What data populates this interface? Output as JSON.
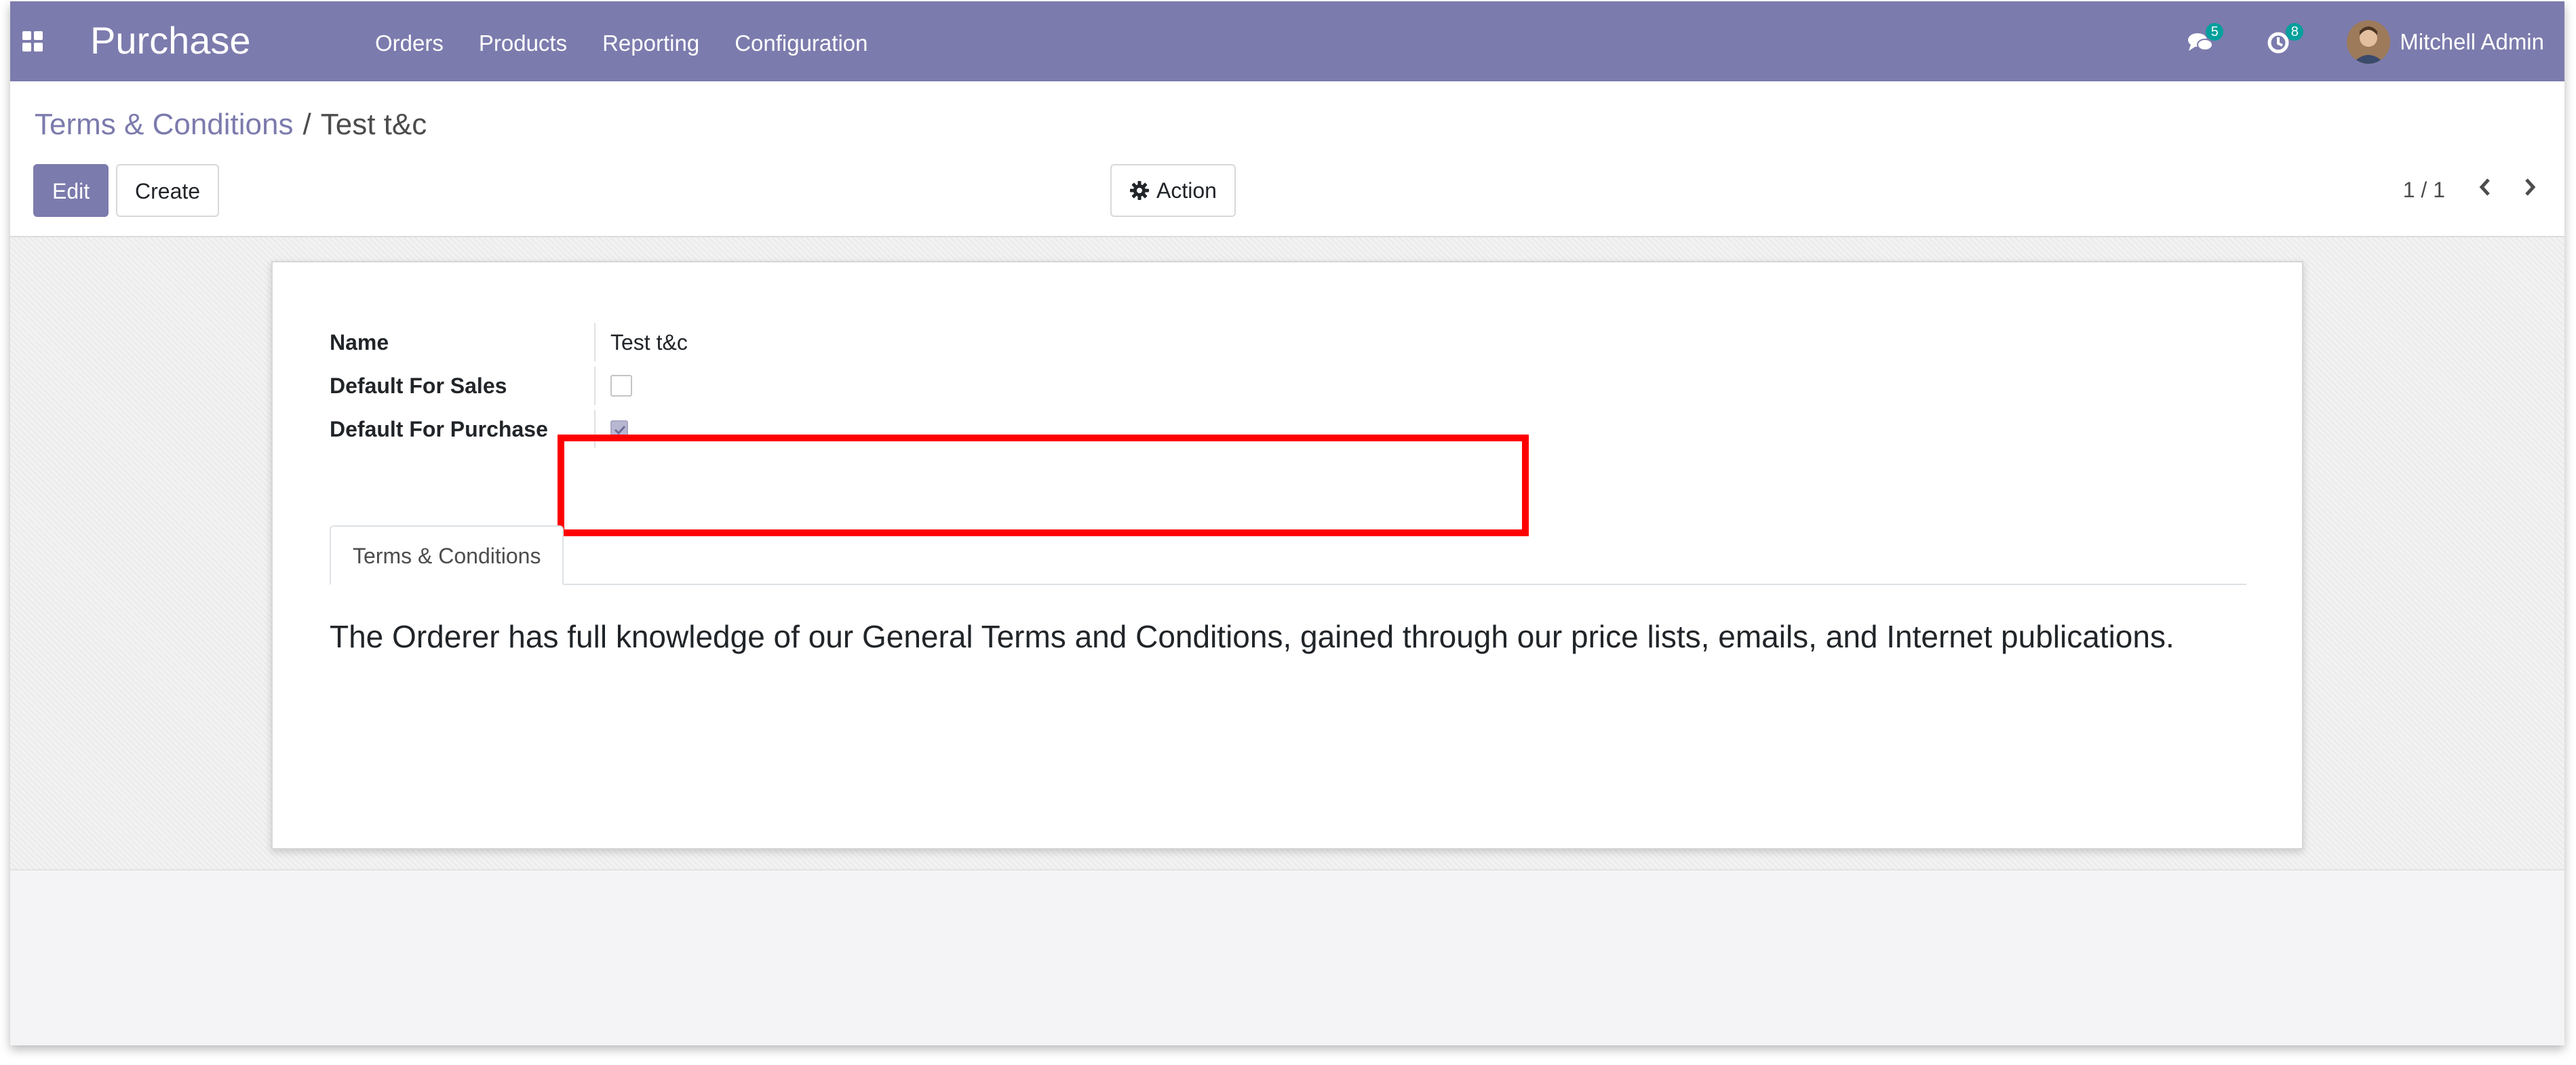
{
  "navbar": {
    "app_title": "Purchase",
    "menu": [
      "Orders",
      "Products",
      "Reporting",
      "Configuration"
    ],
    "messages_count": "5",
    "activities_count": "8",
    "user_name": "Mitchell Admin"
  },
  "breadcrumb": {
    "parent": "Terms & Conditions",
    "separator": "/",
    "current": "Test t&c"
  },
  "buttons": {
    "edit": "Edit",
    "create": "Create",
    "action": "Action"
  },
  "pager": {
    "value": "1 / 1"
  },
  "form": {
    "name_label": "Name",
    "name_value": "Test t&c",
    "default_sales_label": "Default For Sales",
    "default_sales_checked": false,
    "default_purchase_label": "Default For Purchase",
    "default_purchase_checked": true
  },
  "tabs": [
    "Terms & Conditions"
  ],
  "terms_text": "The Orderer has full knowledge of our General Terms and Conditions, gained through our price lists, emails, and Internet publications.",
  "colors": {
    "brand": "#7c7bad",
    "badge": "#00a09d",
    "highlight": "#ff0000"
  }
}
